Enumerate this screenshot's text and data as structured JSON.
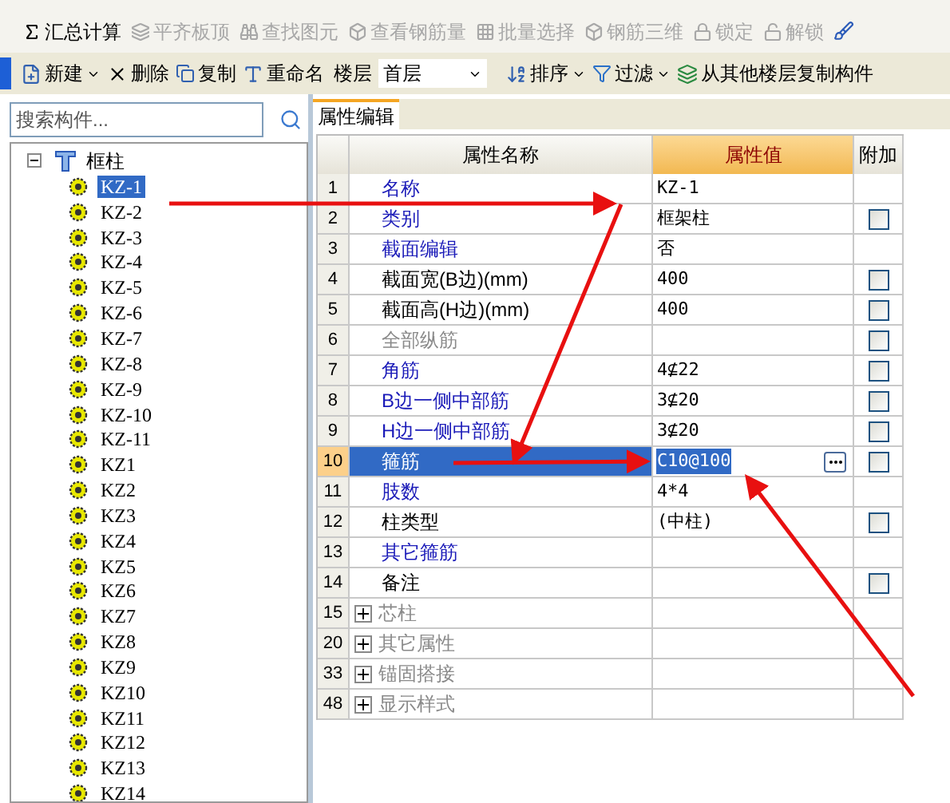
{
  "toolbar": [
    {
      "label": "汇总计算",
      "disabled": false
    },
    {
      "label": "平齐板顶",
      "disabled": true
    },
    {
      "label": "查找图元",
      "disabled": true
    },
    {
      "label": "查看钢筋量",
      "disabled": true
    },
    {
      "label": "批量选择",
      "disabled": true
    },
    {
      "label": "钢筋三维",
      "disabled": true
    },
    {
      "label": "锁定",
      "disabled": true
    },
    {
      "label": "解锁",
      "disabled": true
    }
  ],
  "component_toolbar": {
    "new": "新建",
    "delete": "删除",
    "copy": "复制",
    "rename": "重命名",
    "floor_label": "楼层",
    "floor": "首层",
    "sort": "排序",
    "filter": "过滤",
    "copy_from": "从其他楼层复制构件"
  },
  "search": {
    "placeholder": "搜索构件..."
  },
  "tree": [
    {
      "label": "框柱",
      "expanded": true,
      "children": [
        {
          "label": "KZ-1",
          "selected": true
        },
        {
          "label": "KZ-2",
          "selected": false
        },
        {
          "label": "KZ-3",
          "selected": false
        },
        {
          "label": "KZ-4",
          "selected": false
        },
        {
          "label": "KZ-5",
          "selected": false
        },
        {
          "label": "KZ-6",
          "selected": false
        },
        {
          "label": "KZ-7",
          "selected": false
        },
        {
          "label": "KZ-8",
          "selected": false
        },
        {
          "label": "KZ-9",
          "selected": false
        },
        {
          "label": "KZ-10",
          "selected": false
        },
        {
          "label": "KZ-11",
          "selected": false
        },
        {
          "label": "KZ1",
          "selected": false
        },
        {
          "label": "KZ2",
          "selected": false
        },
        {
          "label": "KZ3",
          "selected": false
        },
        {
          "label": "KZ4",
          "selected": false
        },
        {
          "label": "KZ5",
          "selected": false
        },
        {
          "label": "KZ6",
          "selected": false
        },
        {
          "label": "KZ7",
          "selected": false
        },
        {
          "label": "KZ8",
          "selected": false
        },
        {
          "label": "KZ9",
          "selected": false
        },
        {
          "label": "KZ10",
          "selected": false
        },
        {
          "label": "KZ11",
          "selected": false
        },
        {
          "label": "KZ12",
          "selected": false
        },
        {
          "label": "KZ13",
          "selected": false
        },
        {
          "label": "KZ14",
          "selected": false
        }
      ]
    }
  ],
  "tab": {
    "label": "属性编辑",
    "selected": true
  },
  "table": {
    "columns": [
      "属性名称",
      "属性值",
      "附加"
    ],
    "rows": [
      {
        "num": "1",
        "name": "名称",
        "kind": "link",
        "value": "KZ-1",
        "selected": false
      },
      {
        "num": "2",
        "name": "类别",
        "kind": "link",
        "value": "框架柱",
        "selected": false,
        "checked": false
      },
      {
        "num": "3",
        "name": "截面编辑",
        "kind": "link",
        "value": "否",
        "selected": false
      },
      {
        "num": "4",
        "name": "截面宽(B边)(mm)",
        "kind": "plain",
        "value": "400",
        "selected": false,
        "checked": false
      },
      {
        "num": "5",
        "name": "截面高(H边)(mm)",
        "kind": "plain",
        "value": "400",
        "selected": false,
        "checked": false
      },
      {
        "num": "6",
        "name": "全部纵筋",
        "kind": "muted",
        "selected": false,
        "checked": false
      },
      {
        "num": "7",
        "name": "角筋",
        "kind": "link",
        "value": "4⊈22",
        "selected": false,
        "checked": false
      },
      {
        "num": "8",
        "name": "B边一侧中部筋",
        "kind": "link",
        "value": "3⊈20",
        "selected": false,
        "checked": false
      },
      {
        "num": "9",
        "name": "H边一侧中部筋",
        "kind": "link",
        "value": "3⊈20",
        "selected": false,
        "checked": false
      },
      {
        "num": "10",
        "name": "箍筋",
        "kind": "link",
        "value": "C10@100",
        "selected": true,
        "checked": false
      },
      {
        "num": "11",
        "name": "肢数",
        "kind": "link",
        "value": "4*4",
        "selected": false
      },
      {
        "num": "12",
        "name": "柱类型",
        "kind": "plain",
        "value": "(中柱)",
        "selected": false,
        "checked": false
      },
      {
        "num": "13",
        "name": "其它箍筋",
        "kind": "link",
        "selected": false
      },
      {
        "num": "14",
        "name": "备注",
        "kind": "plain",
        "selected": false,
        "checked": false
      },
      {
        "num": "15",
        "name": "芯柱",
        "kind": "group",
        "selected": false,
        "expanded": false
      },
      {
        "num": "20",
        "name": "其它属性",
        "kind": "group",
        "selected": false,
        "expanded": false
      },
      {
        "num": "33",
        "name": "锚固搭接",
        "kind": "group",
        "selected": false,
        "expanded": false
      },
      {
        "num": "48",
        "name": "显示样式",
        "kind": "group",
        "selected": false,
        "expanded": false
      }
    ]
  }
}
